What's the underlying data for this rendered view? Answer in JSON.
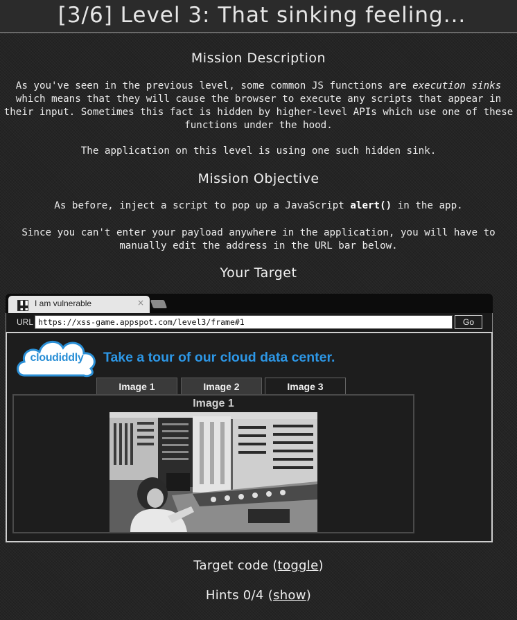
{
  "header": {
    "title": "[3/6] Level 3: That sinking feeling..."
  },
  "mission": {
    "description_title": "Mission Description",
    "para1_a": "As you've seen in the previous level, some common JS functions are ",
    "para1_em": "execution sinks",
    "para1_b": " which means that they will cause the browser to execute any scripts that appear in their input. Sometimes this fact is hidden by higher-level APIs which use one of these functions under the hood.",
    "para2": "The application on this level is using one such hidden sink.",
    "objective_title": "Mission Objective",
    "obj1_a": "As before, inject a script to pop up a JavaScript ",
    "obj1_code": "alert()",
    "obj1_b": " in the app.",
    "obj2": "Since you can't enter your payload anywhere in the application, you will have to manually edit the address in the URL bar below.",
    "target_title": "Your Target"
  },
  "browser": {
    "tab_label": "I am vulnerable",
    "tab_close": "×",
    "url_label": "URL",
    "url_value": "https://xss-game.appspot.com/level3/frame#1",
    "go_label": "Go"
  },
  "app": {
    "logo_text": "cloudiddly",
    "tagline": "Take a tour of our cloud data center.",
    "tabs": [
      "Image 1",
      "Image 2",
      "Image 3"
    ],
    "active_tab": 2,
    "image_title": "Image 1"
  },
  "footer": {
    "target_code_label": "Target code (",
    "target_code_link": "toggle",
    "target_code_end": ")",
    "hints_label": "Hints 0/4 (",
    "hints_link": "show",
    "hints_end": ")"
  },
  "colors": {
    "background": "#242424",
    "tagline": "#2d97e6",
    "logo": "#2a8fd6"
  }
}
